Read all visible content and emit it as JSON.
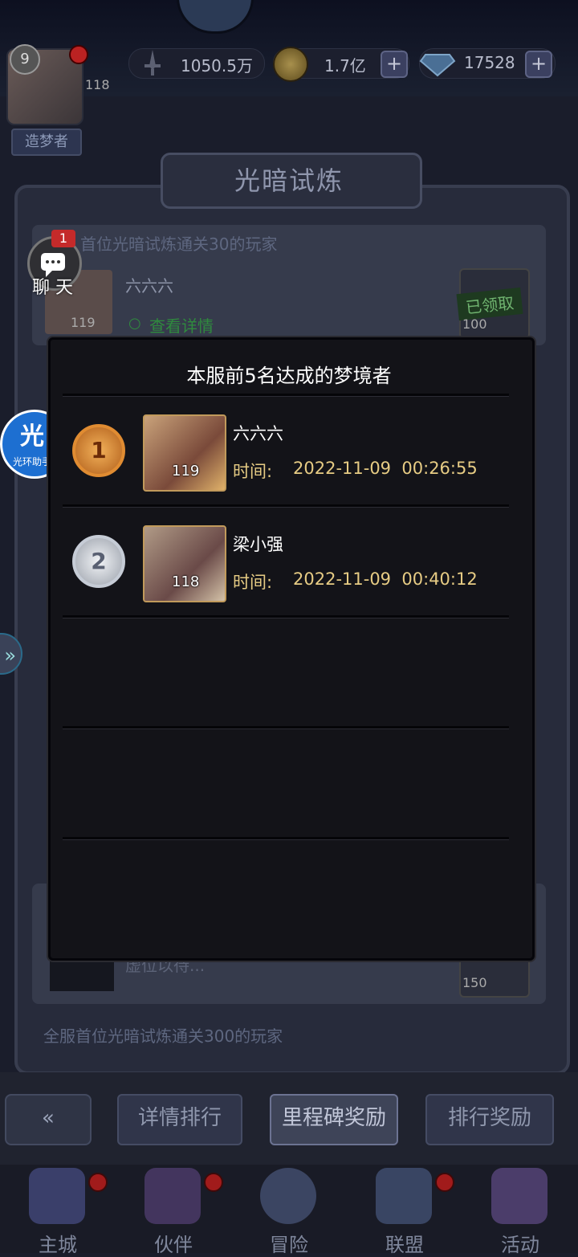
{
  "header": {
    "player_level": "9",
    "avatar_level": "118",
    "player_title": "造梦者",
    "power": "1050.5万",
    "gold": "1.7亿",
    "diamonds": "17528",
    "plus": "+"
  },
  "panel": {
    "title": "光暗试炼",
    "row1_condition": "首位光暗试炼通关30的玩家",
    "row1_player": "六六六",
    "row1_level": "119",
    "row1_view": "查看详情",
    "row1_claimed": "已领取",
    "row1_reward": "100",
    "row_last_player": "虚位以待...",
    "row_last_reward": "150",
    "row_bottom_condition": "全服首位光暗试炼通关300的玩家"
  },
  "chat": {
    "badge": "1",
    "label": "聊 天"
  },
  "helper": {
    "glyph": "光",
    "label": "光环助手"
  },
  "side_arrow": "»",
  "modal": {
    "title": "本服前5名达成的梦境者",
    "entries": [
      {
        "rank": "1",
        "name": "六六六",
        "level": "119",
        "time_label": "时间:",
        "time": "2022-11-09  00:26:55"
      },
      {
        "rank": "2",
        "name": "梁小强",
        "level": "118",
        "time_label": "时间:",
        "time": "2022-11-09  00:40:12"
      }
    ]
  },
  "tabs": {
    "back": "«",
    "ranking_detail": "详情排行",
    "milestone_reward": "里程碑奖励",
    "ranking_reward": "排行奖励"
  },
  "nav": [
    {
      "label": "主城"
    },
    {
      "label": "伙伴"
    },
    {
      "label": "冒险"
    },
    {
      "label": "联盟"
    },
    {
      "label": "活动"
    }
  ],
  "colors": {
    "gold_text": "#e7cc84",
    "medal_gold": "#e08c32",
    "medal_silver": "#c6ccd6",
    "helper_blue": "#1d6fd1"
  }
}
